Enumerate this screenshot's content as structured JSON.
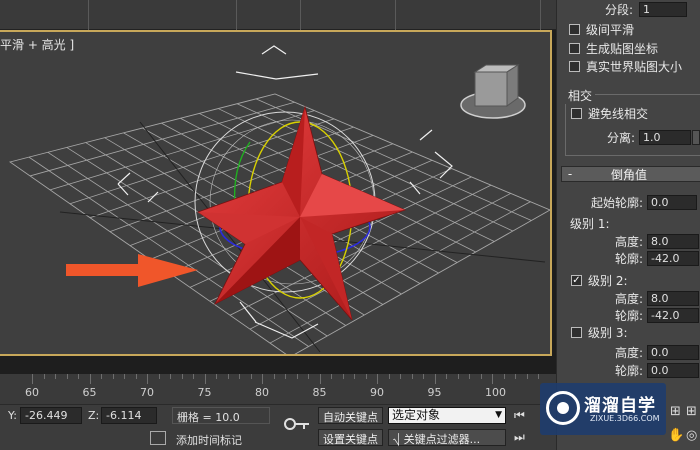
{
  "viewport": {
    "label": "平滑 + 高光 ]"
  },
  "panel": {
    "segments_label": "分段:",
    "segments_value": "1",
    "cb_level_smooth": "级间平滑",
    "cb_gen_mapping": "生成贴图坐标",
    "cb_real_world": "真实世界贴图大小",
    "intersect_group": "相交",
    "cb_avoid_intersect": "避免线相交",
    "separation_label": "分离:",
    "separation_value": "1.0",
    "bevel_sign": "-",
    "bevel_title": "倒角值",
    "start_outline_label": "起始轮廓:",
    "start_outline_value": "0.0",
    "level1_label": "级别 1:",
    "level1_height_label": "高度:",
    "level1_height_value": "8.0",
    "level1_outline_label": "轮廓:",
    "level1_outline_value": "-42.0",
    "level2_checked": "✓",
    "level2_label": "级别 2:",
    "level2_height_label": "高度:",
    "level2_height_value": "8.0",
    "level2_outline_label": "轮廓:",
    "level2_outline_value": "-42.0",
    "level3_label": "级别 3:",
    "level3_height_label": "高度:",
    "level3_height_value": "0.0",
    "level3_outline_label": "轮廓:",
    "level3_outline_value": "0.0"
  },
  "ruler": {
    "labels": [
      "60",
      "65",
      "70",
      "75",
      "80",
      "85",
      "90",
      "95",
      "100"
    ]
  },
  "bottom": {
    "y_label": "Y:",
    "y_value": "-26.449",
    "z_label": "Z:",
    "z_value": "-6.114",
    "grid_text": "栅格 = 10.0",
    "auto_key": "自动关键点",
    "selected_object": "选定对象",
    "set_key": "设置关键点",
    "key_filters": "关键点过滤器...",
    "add_time_tag": "添加时间标记"
  },
  "watermark": {
    "title": "溜溜自学",
    "url": "ZIXUE.3D66.COM"
  },
  "colors": {
    "star_red": "#d42a2a",
    "arrow_orange": "#f0562a",
    "viewport_border": "#c8a85a",
    "watermark_blue": "#1e3c6e"
  }
}
